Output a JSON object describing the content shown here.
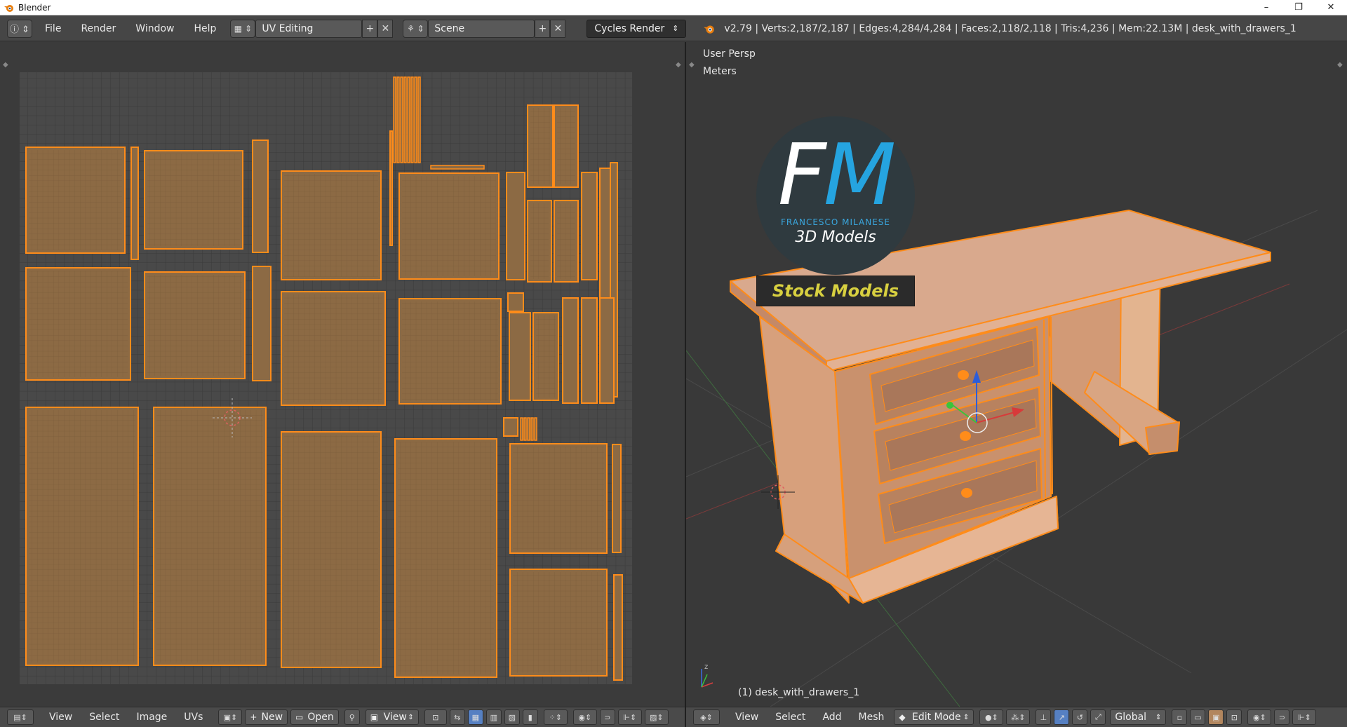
{
  "window": {
    "title": "Blender",
    "controls": [
      "–",
      "❐",
      "✕"
    ]
  },
  "infobar": {
    "menus": [
      "File",
      "Render",
      "Window",
      "Help"
    ],
    "screen_layout": "UV Editing",
    "scene": "Scene",
    "render_engine": "Cycles Render",
    "stats": "v2.79 | Verts:2,187/2,187 | Edges:4,284/4,284 | Faces:2,118/2,118 | Tris:4,236 | Mem:22.13M | desk_with_drawers_1"
  },
  "uv_editor": {
    "menus": [
      "View",
      "Select",
      "Image",
      "UVs"
    ],
    "new_label": "New",
    "open_label": "Open",
    "view_label": "View"
  },
  "view3d": {
    "view_name": "User Persp",
    "units": "Meters",
    "object_label": "(1) desk_with_drawers_1",
    "menus": [
      "View",
      "Select",
      "Add",
      "Mesh"
    ],
    "mode": "Edit Mode",
    "orientation": "Global"
  },
  "watermark": {
    "logo_letters": "FM",
    "logo_name": "FRANCESCO MILANESE",
    "logo_sub": "3D Models",
    "stock_label": "Stock Models"
  },
  "colors": {
    "uv_fill": "#8c6a44",
    "uv_edge": "#ff8c1a",
    "desk_fill": "#d8a080",
    "accent": "#e8a030"
  }
}
